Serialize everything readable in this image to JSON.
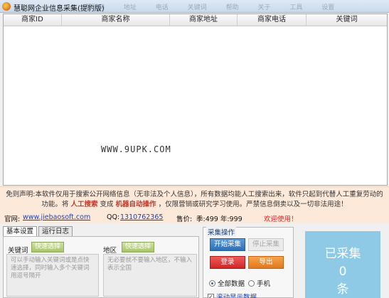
{
  "window": {
    "title": "慧聪网企业信息采集(提豹版)",
    "bg_tabs": [
      "慧聪网",
      "地址",
      "电话",
      "关键词",
      "帮助",
      "关于",
      "工具",
      "设置"
    ]
  },
  "grid": {
    "columns": [
      "商家ID",
      "商家名称",
      "商家地址",
      "商家电话",
      "关键词"
    ],
    "watermark": "WWW.9UPK.COM"
  },
  "notice": {
    "text1": "免则声明:本软件仅用于搜索公开网络信息（无非法及个人信息），所有数据均能人工搜索出来，软件只起到代替人工重复劳动的功能。将",
    "em1": "人工搜索",
    "text2": "变成",
    "em2": "机器自动操作",
    "text3": "，仅限营销或研究学习使用。严禁信息倒卖以及一切非法用途！"
  },
  "info": {
    "site_label": "官网:",
    "site_url": "www.jiebaosoft.com",
    "qq_label": "QQ:",
    "qq": "1310762365",
    "price_label": "售价:",
    "price_value": "季:499 年:999",
    "welcome": "欢迎使用！"
  },
  "tabs": [
    "基本设置",
    "运行日志"
  ],
  "settings": {
    "keyword_label": "关键词",
    "keyword_btn": "快速选择",
    "keyword_hint": "可以手动输入关键词或是点快速选择，同时输入多个关键词用逗号隔开",
    "region_label": "地区",
    "region_btn": "快速选择",
    "region_hint": "无必要就不要输入地区，不输入表示全国"
  },
  "ops": {
    "legend": "采集操作",
    "start": "开始采集",
    "stop": "停止采集",
    "login": "登录",
    "export": "导出",
    "radio_all": "全部数据",
    "radio_mobile": "手机",
    "scroll_check": "滚动显示数据"
  },
  "counter": {
    "line1": "已采集",
    "line2": "0",
    "line3": "条"
  }
}
